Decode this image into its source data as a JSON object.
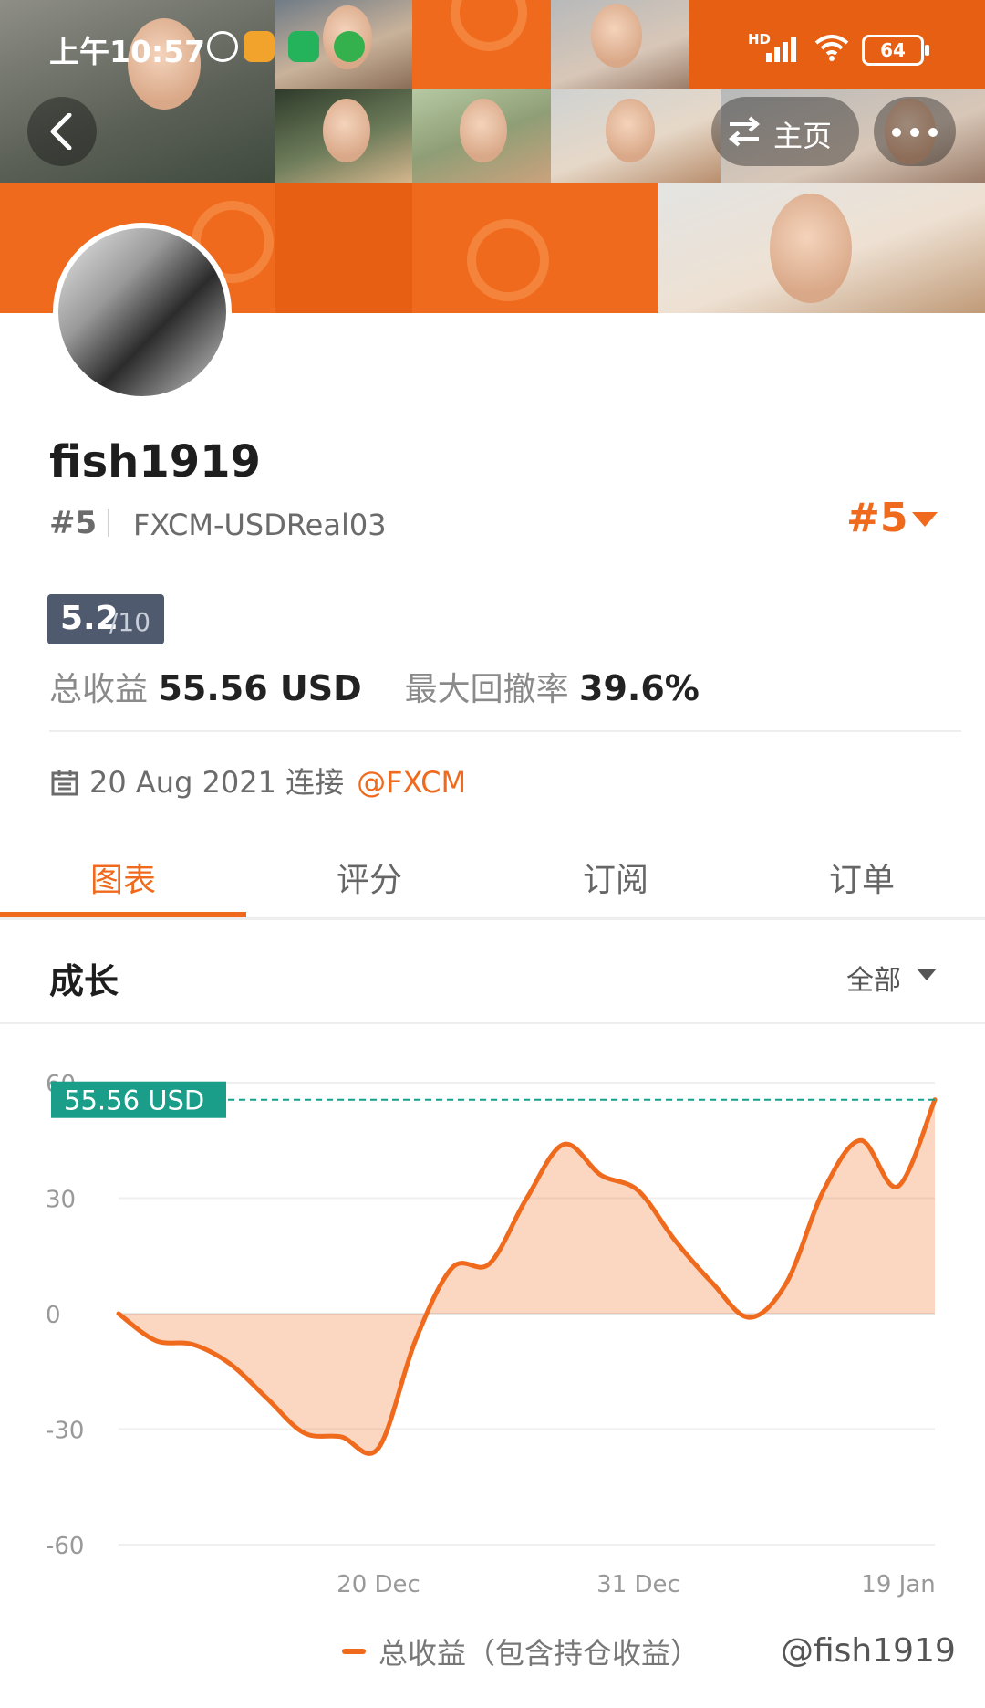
{
  "status_bar": {
    "time": "上午10:57",
    "battery": "64",
    "network": "HD"
  },
  "header": {
    "home_label": "主页"
  },
  "profile": {
    "username": "fish1919",
    "rank": "#5",
    "server": "FXCM-USDReal03",
    "rank_badge": "#5",
    "score": "5.2",
    "score_max": "/10",
    "total_profit_label": "总收益",
    "total_profit_value": "55.56 USD",
    "max_drawdown_label": "最大回撤率",
    "max_drawdown_value": "39.6%",
    "joined_text": "20 Aug 2021 连接",
    "broker": "@FXCM"
  },
  "tabs": [
    {
      "label": "图表",
      "active": true
    },
    {
      "label": "评分",
      "active": false
    },
    {
      "label": "订阅",
      "active": false
    },
    {
      "label": "订单",
      "active": false
    }
  ],
  "section": {
    "title": "成长",
    "filter": "全部"
  },
  "chart_data": {
    "type": "area",
    "series": [
      {
        "name": "总收益（包含持仓收益）",
        "color": "#ef6a1c",
        "values": [
          0,
          -7,
          -8,
          -13,
          -22,
          -31,
          -32,
          -35,
          -7,
          12,
          13,
          30,
          44,
          36,
          32,
          19,
          8,
          -1,
          8,
          32,
          45,
          33,
          55.56
        ]
      }
    ],
    "x_ticks": [
      "20 Dec",
      "31 Dec",
      "19 Jan"
    ],
    "y_ticks": [
      60,
      30,
      0,
      -30,
      -60
    ],
    "ylim": [
      -60,
      60
    ],
    "current_value_label": "55.56 USD",
    "current_value": 55.56,
    "accent": "#ef6a1c",
    "marker_color": "#1a9e8a",
    "grid": true,
    "legend": "bottom"
  },
  "watermark": "@fish1919"
}
